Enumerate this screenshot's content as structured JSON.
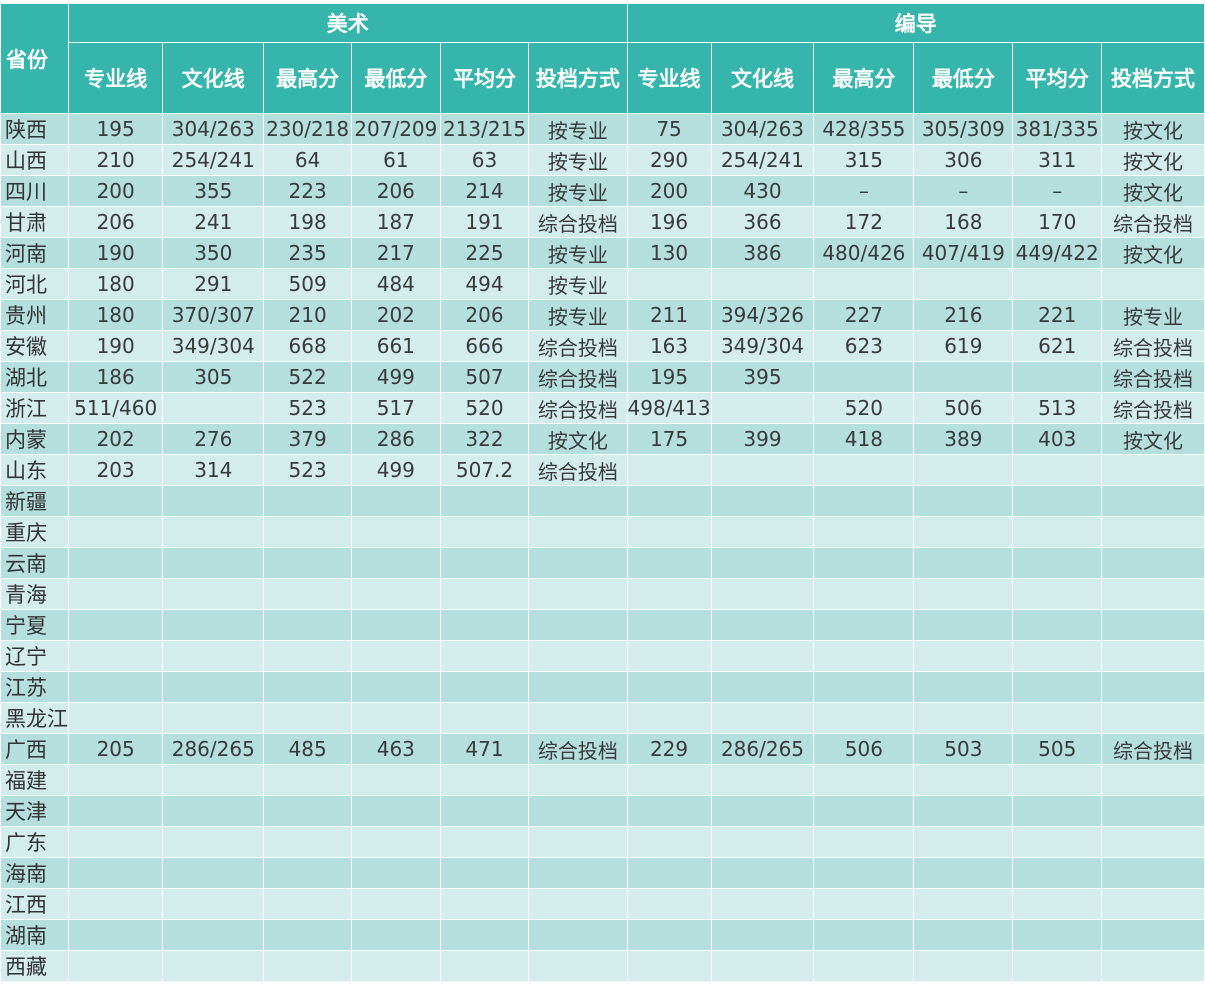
{
  "header": {
    "province": "省份",
    "group_art": "美术",
    "group_directing": "编导",
    "columns": [
      "专业线",
      "文化线",
      "最高分",
      "最低分",
      "平均分",
      "投档方式"
    ]
  },
  "rows": [
    {
      "province": "陕西",
      "art": [
        "195",
        "304/263",
        "230/218",
        "207/209",
        "213/215",
        "按专业"
      ],
      "dir": [
        "75",
        "304/263",
        "428/355",
        "305/309",
        "381/335",
        "按文化"
      ]
    },
    {
      "province": "山西",
      "art": [
        "210",
        "254/241",
        "64",
        "61",
        "63",
        "按专业"
      ],
      "dir": [
        "290",
        "254/241",
        "315",
        "306",
        "311",
        "按文化"
      ]
    },
    {
      "province": "四川",
      "art": [
        "200",
        "355",
        "223",
        "206",
        "214",
        "按专业"
      ],
      "dir": [
        "200",
        "430",
        "–",
        "–",
        "–",
        "按文化"
      ]
    },
    {
      "province": "甘肃",
      "art": [
        "206",
        "241",
        "198",
        "187",
        "191",
        "综合投档"
      ],
      "dir": [
        "196",
        "366",
        "172",
        "168",
        "170",
        "综合投档"
      ]
    },
    {
      "province": "河南",
      "art": [
        "190",
        "350",
        "235",
        "217",
        "225",
        "按专业"
      ],
      "dir": [
        "130",
        "386",
        "480/426",
        "407/419",
        "449/422",
        "按文化"
      ]
    },
    {
      "province": "河北",
      "art": [
        "180",
        "291",
        "509",
        "484",
        "494",
        "按专业"
      ],
      "dir": [
        "",
        "",
        "",
        "",
        "",
        ""
      ]
    },
    {
      "province": "贵州",
      "art": [
        "180",
        "370/307",
        "210",
        "202",
        "206",
        "按专业"
      ],
      "dir": [
        "211",
        "394/326",
        "227",
        "216",
        "221",
        "按专业"
      ]
    },
    {
      "province": "安徽",
      "art": [
        "190",
        "349/304",
        "668",
        "661",
        "666",
        "综合投档"
      ],
      "dir": [
        "163",
        "349/304",
        "623",
        "619",
        "621",
        "综合投档"
      ]
    },
    {
      "province": "湖北",
      "art": [
        "186",
        "305",
        "522",
        "499",
        "507",
        "综合投档"
      ],
      "dir": [
        "195",
        "395",
        "",
        "",
        "",
        "综合投档"
      ]
    },
    {
      "province": "浙江",
      "art": [
        "511/460",
        "",
        "523",
        "517",
        "520",
        "综合投档"
      ],
      "dir": [
        "498/413",
        "",
        "520",
        "506",
        "513",
        "综合投档"
      ]
    },
    {
      "province": "内蒙",
      "art": [
        "202",
        "276",
        "379",
        "286",
        "322",
        "按文化"
      ],
      "dir": [
        "175",
        "399",
        "418",
        "389",
        "403",
        "按文化"
      ]
    },
    {
      "province": "山东",
      "art": [
        "203",
        "314",
        "523",
        "499",
        "507.2",
        "综合投档"
      ],
      "dir": [
        "",
        "",
        "",
        "",
        "",
        ""
      ]
    },
    {
      "province": "新疆",
      "art": [
        "",
        "",
        "",
        "",
        "",
        ""
      ],
      "dir": [
        "",
        "",
        "",
        "",
        "",
        ""
      ]
    },
    {
      "province": "重庆",
      "art": [
        "",
        "",
        "",
        "",
        "",
        ""
      ],
      "dir": [
        "",
        "",
        "",
        "",
        "",
        ""
      ]
    },
    {
      "province": "云南",
      "art": [
        "",
        "",
        "",
        "",
        "",
        ""
      ],
      "dir": [
        "",
        "",
        "",
        "",
        "",
        ""
      ]
    },
    {
      "province": "青海",
      "art": [
        "",
        "",
        "",
        "",
        "",
        ""
      ],
      "dir": [
        "",
        "",
        "",
        "",
        "",
        ""
      ]
    },
    {
      "province": "宁夏",
      "art": [
        "",
        "",
        "",
        "",
        "",
        ""
      ],
      "dir": [
        "",
        "",
        "",
        "",
        "",
        ""
      ]
    },
    {
      "province": "辽宁",
      "art": [
        "",
        "",
        "",
        "",
        "",
        ""
      ],
      "dir": [
        "",
        "",
        "",
        "",
        "",
        ""
      ]
    },
    {
      "province": "江苏",
      "art": [
        "",
        "",
        "",
        "",
        "",
        ""
      ],
      "dir": [
        "",
        "",
        "",
        "",
        "",
        ""
      ]
    },
    {
      "province": "黑龙江",
      "art": [
        "",
        "",
        "",
        "",
        "",
        ""
      ],
      "dir": [
        "",
        "",
        "",
        "",
        "",
        ""
      ]
    },
    {
      "province": "广西",
      "art": [
        "205",
        "286/265",
        "485",
        "463",
        "471",
        "综合投档"
      ],
      "dir": [
        "229",
        "286/265",
        "506",
        "503",
        "505",
        "综合投档"
      ]
    },
    {
      "province": "福建",
      "art": [
        "",
        "",
        "",
        "",
        "",
        ""
      ],
      "dir": [
        "",
        "",
        "",
        "",
        "",
        ""
      ]
    },
    {
      "province": "天津",
      "art": [
        "",
        "",
        "",
        "",
        "",
        ""
      ],
      "dir": [
        "",
        "",
        "",
        "",
        "",
        ""
      ]
    },
    {
      "province": "广东",
      "art": [
        "",
        "",
        "",
        "",
        "",
        ""
      ],
      "dir": [
        "",
        "",
        "",
        "",
        "",
        ""
      ]
    },
    {
      "province": "海南",
      "art": [
        "",
        "",
        "",
        "",
        "",
        ""
      ],
      "dir": [
        "",
        "",
        "",
        "",
        "",
        ""
      ]
    },
    {
      "province": "江西",
      "art": [
        "",
        "",
        "",
        "",
        "",
        ""
      ],
      "dir": [
        "",
        "",
        "",
        "",
        "",
        ""
      ]
    },
    {
      "province": "湖南",
      "art": [
        "",
        "",
        "",
        "",
        "",
        ""
      ],
      "dir": [
        "",
        "",
        "",
        "",
        "",
        ""
      ]
    },
    {
      "province": "西藏",
      "art": [
        "",
        "",
        "",
        "",
        "",
        ""
      ],
      "dir": [
        "",
        "",
        "",
        "",
        "",
        ""
      ]
    }
  ]
}
